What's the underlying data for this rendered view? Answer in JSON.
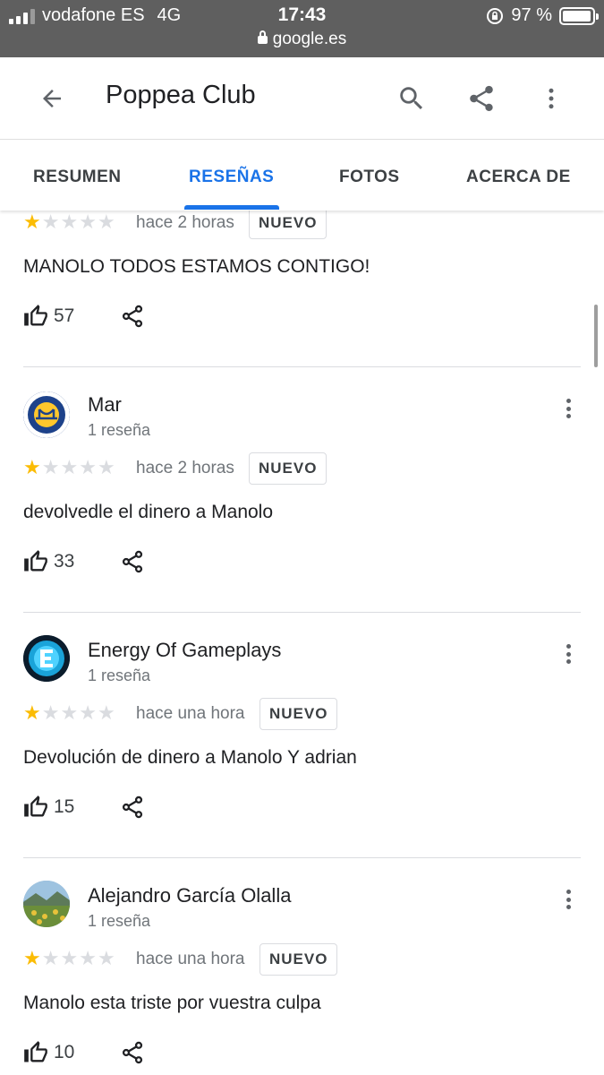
{
  "status_bar": {
    "carrier": "vodafone ES",
    "network": "4G",
    "time": "17:43",
    "battery": "97 %",
    "battery_level": 0.97,
    "url": "google.es"
  },
  "app_bar": {
    "title": "Poppea Club",
    "icons": [
      "back-arrow-icon",
      "search-icon",
      "share-icon",
      "more-vert-icon"
    ]
  },
  "tabs": [
    {
      "label": "RESUMEN",
      "active": false
    },
    {
      "label": "RESEÑAS",
      "active": true
    },
    {
      "label": "FOTOS",
      "active": false
    },
    {
      "label": "ACERCA DE",
      "active": false
    }
  ],
  "colors": {
    "accent": "#1a73e8",
    "star_on": "#fbbc04",
    "star_off": "#dadce0"
  },
  "reviews": [
    {
      "author": "",
      "review_count": "",
      "rating": 1,
      "time": "hace 2 horas",
      "badge": "NUEVO",
      "text": "MANOLO TODOS ESTAMOS CONTIGO!",
      "likes": "57"
    },
    {
      "author": "Mar",
      "review_count": "1 reseña",
      "rating": 1,
      "time": "hace 2 horas",
      "badge": "NUEVO",
      "text": "devolvedle el dinero a Manolo",
      "likes": "33"
    },
    {
      "author": "Energy Of Gameplays",
      "review_count": "1 reseña",
      "rating": 1,
      "time": "hace una hora",
      "badge": "NUEVO",
      "text": "Devolución de dinero a Manolo Y adrian",
      "likes": "15"
    },
    {
      "author": "Alejandro García Olalla",
      "review_count": "1 reseña",
      "rating": 1,
      "time": "hace una hora",
      "badge": "NUEVO",
      "text": "Manolo esta triste por vuestra culpa",
      "likes": "10"
    }
  ]
}
